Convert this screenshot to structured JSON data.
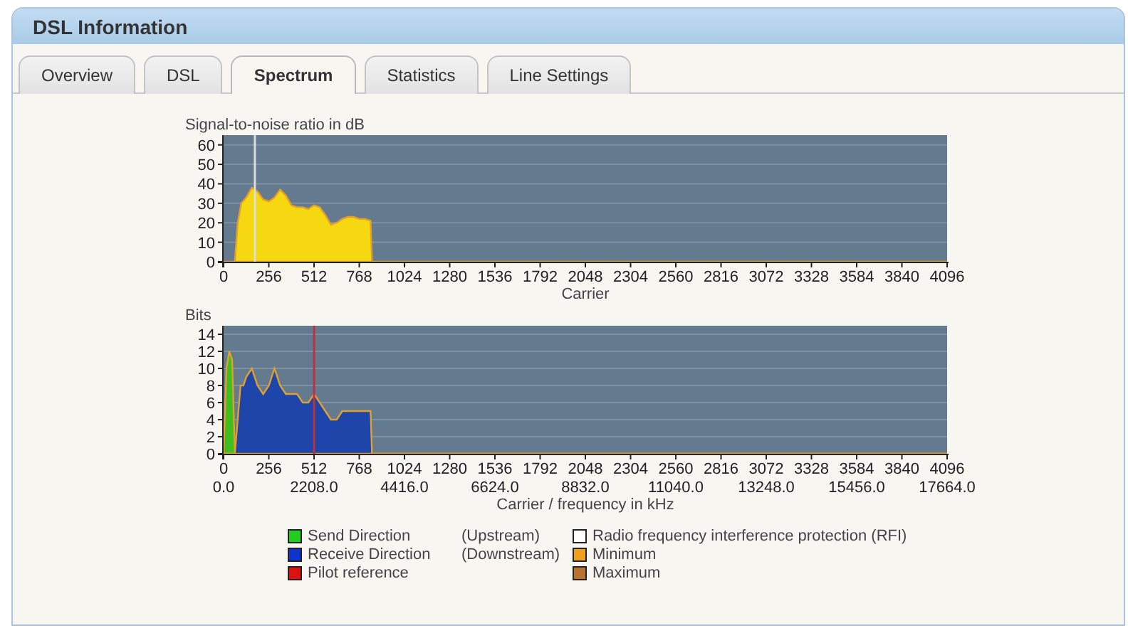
{
  "window": {
    "title": "DSL Information"
  },
  "tabs": [
    {
      "label": "Overview",
      "selected": false
    },
    {
      "label": "DSL",
      "selected": false
    },
    {
      "label": "Spectrum",
      "selected": true
    },
    {
      "label": "Statistics",
      "selected": false
    },
    {
      "label": "Line Settings",
      "selected": false
    }
  ],
  "snr_chart": {
    "chart_data": {
      "type": "area",
      "ylabel": "Signal-to-noise ratio in dB",
      "xlabel": "Carrier",
      "x": [
        0,
        64,
        80,
        100,
        128,
        160,
        192,
        224,
        256,
        288,
        320,
        352,
        384,
        416,
        448,
        480,
        512,
        544,
        576,
        608,
        640,
        672,
        704,
        736,
        768,
        800,
        832,
        840,
        4096
      ],
      "series": [
        {
          "color": "#f5d80f",
          "values": [
            0,
            0,
            20,
            30,
            33,
            38,
            36,
            32,
            31,
            33,
            37,
            34,
            29,
            28,
            28,
            27,
            29,
            28,
            24,
            19,
            20,
            22,
            23,
            23,
            22,
            22,
            21,
            0,
            0
          ]
        }
      ],
      "xlim": [
        0,
        4096
      ],
      "ylim": [
        0,
        65
      ],
      "xticks": [
        0,
        256,
        512,
        768,
        1024,
        1280,
        1536,
        1792,
        2048,
        2304,
        2560,
        2816,
        3072,
        3328,
        3584,
        3840,
        4096
      ],
      "yticks": [
        0,
        10,
        20,
        30,
        40,
        50,
        60
      ],
      "grid": true,
      "ref_lines": [
        {
          "axis": "x",
          "value": 177
        }
      ]
    }
  },
  "bits_chart": {
    "chart_data": {
      "type": "area",
      "ylabel": "Bits",
      "xlabel": "Carrier / frequency in kHz",
      "x": [
        0,
        16,
        32,
        48,
        64,
        80,
        96,
        112,
        128,
        160,
        192,
        224,
        256,
        288,
        320,
        352,
        384,
        416,
        448,
        480,
        512,
        544,
        576,
        608,
        640,
        672,
        704,
        736,
        768,
        800,
        832,
        840,
        4096
      ],
      "series": [
        {
          "color": "#3fbf1f",
          "values": [
            0,
            10,
            12,
            11,
            0,
            0,
            0,
            0,
            0,
            0,
            0,
            0,
            0,
            0,
            0,
            0,
            0,
            0,
            0,
            0,
            0,
            0,
            0,
            0,
            0,
            0,
            0,
            0,
            0,
            0,
            0,
            0,
            0
          ]
        },
        {
          "color": "#1d45aa",
          "values": [
            0,
            0,
            0,
            0,
            0,
            4,
            8,
            8,
            9,
            10,
            8,
            7,
            8,
            10,
            8,
            7,
            7,
            7,
            6,
            6,
            7,
            6,
            5,
            4,
            4,
            5,
            5,
            5,
            5,
            5,
            5,
            0,
            0
          ]
        }
      ],
      "xlim": [
        0,
        4096
      ],
      "ylim": [
        0,
        15
      ],
      "xticks": [
        0,
        256,
        512,
        768,
        1024,
        1280,
        1536,
        1792,
        2048,
        2304,
        2560,
        2816,
        3072,
        3328,
        3584,
        3840,
        4096
      ],
      "yticks": [
        0,
        2,
        4,
        6,
        8,
        10,
        12,
        14
      ],
      "grid": true,
      "ref_lines": [
        {
          "axis": "x",
          "value": 512
        }
      ]
    },
    "frequency_labels": [
      "0.0",
      "2208.0",
      "4416.0",
      "6624.0",
      "8832.0",
      "11040.0",
      "13248.0",
      "15456.0",
      "17664.0"
    ]
  },
  "legend": [
    {
      "label": "Send Direction",
      "note": "(Upstream)",
      "color": "#22cc22"
    },
    {
      "label": "Radio frequency interference protection (RFI)",
      "color": "#ffffff"
    },
    {
      "label": "Receive Direction",
      "note": "(Downstream)",
      "color": "#1133cc"
    },
    {
      "label": "Minimum",
      "color": "#f0a020"
    },
    {
      "label": "Pilot reference",
      "color": "#dd1111"
    },
    {
      "label": "Maximum",
      "color": "#b87333"
    }
  ]
}
